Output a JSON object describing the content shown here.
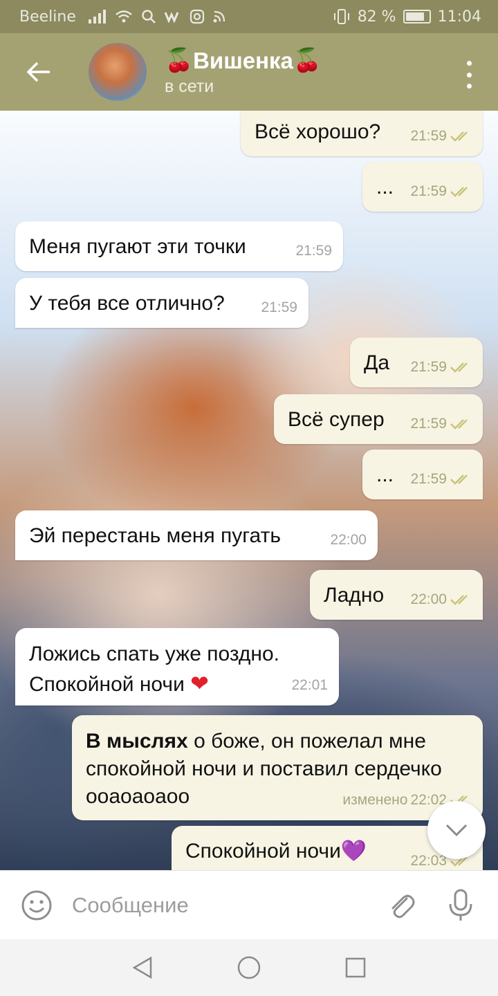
{
  "status_bar": {
    "carrier": "Beeline",
    "battery_text": "82 %",
    "battery_level": 0.82,
    "time": "11:04",
    "icons": [
      "signal-icon",
      "wifi-icon",
      "search-icon",
      "vk-icon",
      "instagram-icon",
      "rss-icon",
      "vibrate-icon",
      "battery-icon"
    ]
  },
  "header": {
    "title": "Вишенка",
    "title_emoji": "🍒",
    "status": "в сети",
    "icons": [
      "back-arrow-icon",
      "avatar",
      "more-vertical-icon"
    ]
  },
  "messages": [
    {
      "dir": "out",
      "text": "Всё хорошо?",
      "time": "21:59",
      "read": true
    },
    {
      "dir": "out",
      "text": "...",
      "time": "21:59",
      "read": true
    },
    {
      "dir": "in",
      "text": "Меня пугают эти точки",
      "time": "21:59"
    },
    {
      "dir": "in",
      "text": "У тебя все отлично?",
      "time": "21:59"
    },
    {
      "dir": "out",
      "text": "Да",
      "time": "21:59",
      "read": true
    },
    {
      "dir": "out",
      "text": "Всё супер",
      "time": "21:59",
      "read": true
    },
    {
      "dir": "out",
      "text": "...",
      "time": "21:59",
      "read": true
    },
    {
      "dir": "in",
      "text": "Эй перестань меня пугать",
      "time": "22:00"
    },
    {
      "dir": "out",
      "text": "Ладно",
      "time": "22:00",
      "read": true
    },
    {
      "dir": "in",
      "text_line1": "Ложись спать уже поздно.",
      "text_line2": "Спокойной ночи",
      "emoji": "❤",
      "time": "22:01"
    },
    {
      "dir": "out",
      "bold_prefix": "В мыслях",
      "text": " о боже, он пожелал мне спокойной ночи и поставил сердечко ооаоаоаоо",
      "edited": "изменено",
      "time": "22:02",
      "read": true
    },
    {
      "dir": "out",
      "text": "Спокойной ночи",
      "emoji": "💜",
      "time": "22:03",
      "read": true
    }
  ],
  "input": {
    "placeholder": "Сообщение",
    "icons": [
      "emoji-icon",
      "attach-icon",
      "mic-icon"
    ]
  },
  "scroll_button": {
    "icon": "chevron-down-icon"
  },
  "nav_bar": {
    "icons": [
      "back-triangle-icon",
      "home-circle-icon",
      "recents-square-icon"
    ]
  },
  "colors": {
    "header_bg": "#a4a273",
    "status_bar_bg": "#8c8a5e",
    "outgoing_bubble": "#f7f4e4",
    "incoming_bubble": "#ffffff",
    "check_color": "#c9c27a"
  }
}
